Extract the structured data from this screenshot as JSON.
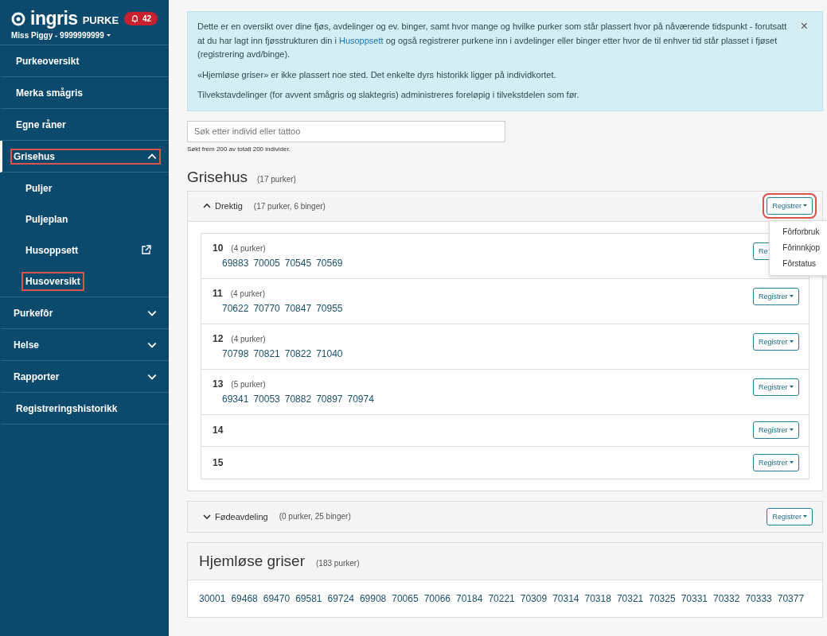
{
  "sidebar": {
    "logo": "ingris",
    "product": "PURKE",
    "notifications": "42",
    "user": "Miss Piggy - 9999999999",
    "items": [
      {
        "label": "Purkeoversikt",
        "selected": false,
        "highlighted": false
      },
      {
        "label": "Merka smågris",
        "selected": false,
        "highlighted": false
      },
      {
        "label": "Egne råner",
        "selected": false,
        "highlighted": false
      },
      {
        "label": "Grisehus",
        "selected": true,
        "highlighted": true,
        "expanded": true,
        "children": [
          {
            "label": "Puljer",
            "highlighted": false,
            "external": false
          },
          {
            "label": "Puljeplan",
            "highlighted": false,
            "external": false
          },
          {
            "label": "Husoppsett",
            "highlighted": false,
            "external": true
          },
          {
            "label": "Husoversikt",
            "highlighted": true,
            "external": false
          }
        ]
      },
      {
        "label": "Purkefôr",
        "selected": false,
        "highlighted": false,
        "expanded": false
      },
      {
        "label": "Helse",
        "selected": false,
        "highlighted": false,
        "expanded": false
      },
      {
        "label": "Rapporter",
        "selected": false,
        "highlighted": false,
        "expanded": false
      },
      {
        "label": "Registreringshistorikk",
        "selected": false,
        "highlighted": false
      }
    ]
  },
  "info": {
    "paragraphs": [
      {
        "before": "Dette er en oversikt over dine fjøs, avdelinger og ev. binger, samt hvor mange og hvilke purker som står plassert hvor på nåværende tidspunkt - forutsatt at du har lagt inn fjøsstrukturen din i",
        "link": "Husoppsett",
        "after": "og også registrerer purkene inn i avdelinger eller binger etter hvor de til enhver tid står plasset i fjøset (registrering avd/binge)."
      },
      {
        "before": "«Hjemløse griser» er ikke plassert noe sted. Det enkelte dyrs historikk ligger på individkortet."
      },
      {
        "before": "Tilvekstavdelinger (for avvent smågris og slaktegris) administreres foreløpig i tilvekstdelen som før."
      }
    ],
    "close": "×"
  },
  "search": {
    "placeholder": "Søk etter individ eller tattoo",
    "hint": "Søkt frem 200 av totalt 200 individer."
  },
  "house": {
    "title": "Grisehus",
    "count": "(17 purker)",
    "sections": [
      {
        "name": "Drektig",
        "count": "(17 purker, 6 binger)",
        "expanded": true,
        "button": "Registrer",
        "highlighted": true,
        "menu": [
          "Fôrforbruk",
          "Fôrinnkjop",
          "Fôrstatus"
        ],
        "bins": [
          {
            "name": "10",
            "count": "(4 purker)",
            "button": "Re",
            "caret": false,
            "animals": [
              "69883",
              "70005",
              "70545",
              "70569"
            ]
          },
          {
            "name": "11",
            "count": "(4 purker)",
            "button": "Registrer",
            "caret": true,
            "animals": [
              "70622",
              "70770",
              "70847",
              "70955"
            ]
          },
          {
            "name": "12",
            "count": "(4 purker)",
            "button": "Registrer",
            "caret": true,
            "animals": [
              "70798",
              "70821",
              "70822",
              "71040"
            ]
          },
          {
            "name": "13",
            "count": "(5 purker)",
            "button": "Registrer",
            "caret": true,
            "animals": [
              "69341",
              "70053",
              "70882",
              "70897",
              "70974"
            ]
          },
          {
            "name": "14",
            "button": "Registrer",
            "caret": true
          },
          {
            "name": "15",
            "button": "Registrer",
            "caret": true
          }
        ]
      },
      {
        "name": "Fødeavdeling",
        "count": "(0 purker, 25 binger)",
        "expanded": false,
        "button": "Registrer",
        "highlighted": false
      }
    ]
  },
  "homeless": {
    "title": "Hjemløse griser",
    "count": "(183 purker)",
    "animals": [
      "30001",
      "69468",
      "69470",
      "69581",
      "69724",
      "69908",
      "70065",
      "70066",
      "70184",
      "70221",
      "70309",
      "70314",
      "70318",
      "70321",
      "70325",
      "70331",
      "70332",
      "70333",
      "70377"
    ]
  }
}
